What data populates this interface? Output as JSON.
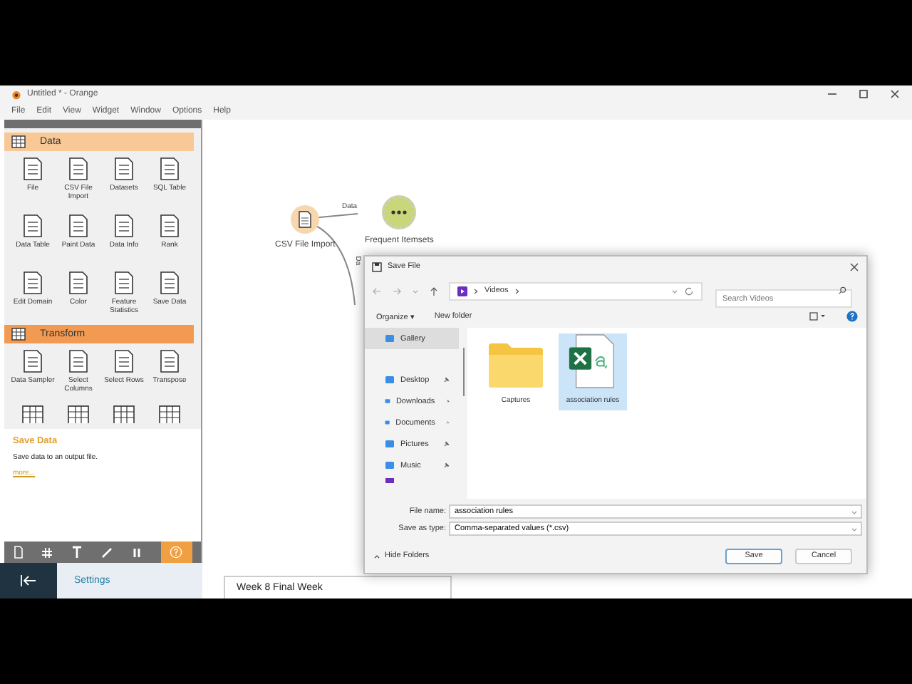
{
  "window": {
    "title": "Untitled * - Orange"
  },
  "menu": [
    "File",
    "Edit",
    "View",
    "Widget",
    "Window",
    "Options",
    "Help"
  ],
  "toolbox": {
    "categories": [
      {
        "name": "Data",
        "kind": "light",
        "widgets": [
          "File",
          "CSV File Import",
          "Datasets",
          "SQL Table",
          "Data Table",
          "Paint Data",
          "Data Info",
          "Rank",
          "Edit Domain",
          "Color",
          "Feature Statistics",
          "Save Data"
        ]
      },
      {
        "name": "Transform",
        "kind": "strong",
        "widgets": [
          "Data Sampler",
          "Select Columns",
          "Select Rows",
          "Transpose"
        ]
      }
    ],
    "help": {
      "title": "Save Data",
      "text": "Save data to an output file.",
      "link": "more..."
    }
  },
  "canvas": {
    "nodes": [
      {
        "label": "CSV File Import",
        "kind": "source"
      },
      {
        "label": "Frequent Itemsets",
        "kind": "target"
      }
    ],
    "links": [
      {
        "label": "Data"
      },
      {
        "label": "Da"
      }
    ]
  },
  "dialog": {
    "title": "Save File",
    "path": "Videos",
    "search": {
      "placeholder": "Search Videos"
    },
    "toolbar": [
      "Organize ▾",
      "New folder"
    ],
    "nav": [
      {
        "label": "Gallery",
        "selected": true,
        "pinned": false
      },
      {
        "label": "Desktop",
        "selected": false,
        "pinned": true
      },
      {
        "label": "Downloads",
        "selected": false,
        "pinned": true
      },
      {
        "label": "Documents",
        "selected": false,
        "pinned": true
      },
      {
        "label": "Pictures",
        "selected": false,
        "pinned": true
      },
      {
        "label": "Music",
        "selected": false,
        "pinned": true
      }
    ],
    "files": [
      {
        "name": "Captures",
        "kind": "folder",
        "selected": false
      },
      {
        "name": "association rules",
        "kind": "csv",
        "selected": true
      }
    ],
    "fields": [
      {
        "label": "File name:",
        "value": "association rules"
      },
      {
        "label": "Save as type:",
        "value": "Comma-separated values (*.csv)"
      }
    ],
    "hide_folders": "Hide Folders",
    "buttons": [
      "Save",
      "Cancel"
    ]
  },
  "background_app": {
    "sidebar_item": "Settings",
    "card_title": "Week 8 Final Week"
  }
}
